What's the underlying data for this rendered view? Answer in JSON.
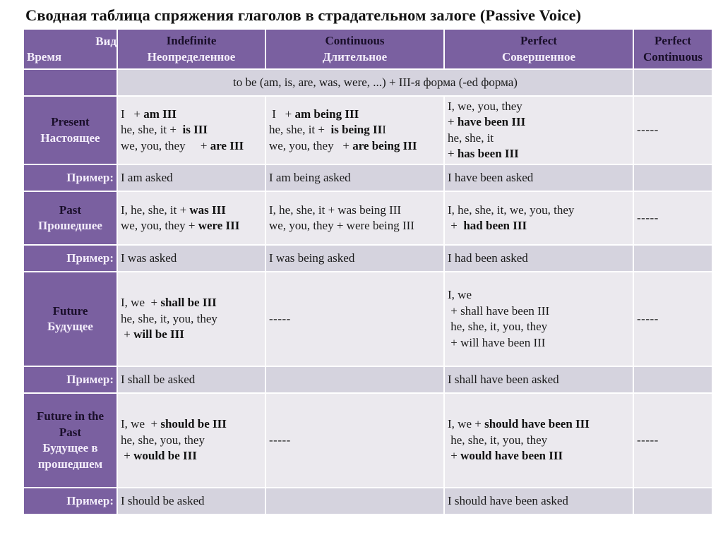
{
  "title": "Сводная таблица спряжения глаголов в страдательном залоге (Passive Voice)",
  "header": {
    "corner_top": "Вид",
    "corner_bottom": "Время",
    "columns": [
      {
        "en": "Indefinite",
        "ru": "Неопределенное"
      },
      {
        "en": "Continuous",
        "ru": "Длительное"
      },
      {
        "en": "Perfect",
        "ru": "Совершенное"
      },
      {
        "en": "Perfect",
        "ru": "Continuous"
      }
    ]
  },
  "formula": "to be (am, is, are, was, were, ...) +  III-я форма (-ed форма)",
  "example_label": "Пример:",
  "dash": "-----",
  "rows": {
    "present": {
      "en": "Present",
      "ru": "Настоящее",
      "indefinite": [
        {
          "pre": "I   + ",
          "bold": "am III",
          "post": ""
        },
        {
          "pre": "he, she, it +  ",
          "bold": "is III",
          "post": ""
        },
        {
          "pre": "we, you, they     + ",
          "bold": "are III",
          "post": ""
        }
      ],
      "continuous": [
        {
          "pre": " I   + ",
          "bold": "am being III",
          "post": ""
        },
        {
          "pre": "he, she, it +  ",
          "bold": "is being II",
          "post": "I"
        },
        {
          "pre": "we, you, they   + ",
          "bold": "are being III",
          "post": ""
        }
      ],
      "perfect": [
        {
          "pre": "I, we, you, they",
          "bold": "",
          "post": ""
        },
        {
          "pre": "+ ",
          "bold": "have been III",
          "post": ""
        },
        {
          "pre": "he, she, it",
          "bold": "",
          "post": ""
        },
        {
          "pre": "+ ",
          "bold": "has been III",
          "post": ""
        }
      ],
      "perfect_continuous": "-----",
      "examples": [
        "I am asked",
        "I am being asked",
        "I have been asked",
        ""
      ]
    },
    "past": {
      "en": "Past",
      "ru": "Прошедшее",
      "indefinite": [
        {
          "pre": "I, he, she, it + ",
          "bold": "was III",
          "post": ""
        },
        {
          "pre": "we, you, they + ",
          "bold": "were III",
          "post": ""
        }
      ],
      "continuous": [
        {
          "pre": "I, he, she, it + was being III",
          "bold": "",
          "post": ""
        },
        {
          "pre": "we, you, they + were being III",
          "bold": "",
          "post": ""
        }
      ],
      "perfect": [
        {
          "pre": "I, he, she, it, we, you, they",
          "bold": "",
          "post": ""
        },
        {
          "pre": " +  ",
          "bold": "had been III",
          "post": ""
        }
      ],
      "perfect_continuous": "-----",
      "examples": [
        "I was asked",
        "I was being asked",
        "I had been asked",
        ""
      ]
    },
    "future": {
      "en": "Future",
      "ru": "Будущее",
      "indefinite": [
        {
          "pre": "I, we  + ",
          "bold": "shall be III",
          "post": ""
        },
        {
          "pre": "he, she, it, you, they",
          "bold": "",
          "post": ""
        },
        {
          "pre": " + ",
          "bold": "will be III",
          "post": ""
        }
      ],
      "continuous": "-----",
      "perfect": [
        {
          "pre": "I, we",
          "bold": "",
          "post": ""
        },
        {
          "pre": " + shall have been III",
          "bold": "",
          "post": ""
        },
        {
          "pre": " he, she, it, you, they",
          "bold": "",
          "post": ""
        },
        {
          "pre": " + will have been III",
          "bold": "",
          "post": ""
        }
      ],
      "perfect_continuous": "-----",
      "examples": [
        "I shall be asked",
        "",
        "I shall have been asked",
        ""
      ]
    },
    "future_in_past": {
      "en": "Future in the Past",
      "ru": "Будущее в прошедшем",
      "indefinite": [
        {
          "pre": "I, we  + ",
          "bold": "should be III",
          "post": ""
        },
        {
          "pre": "he, she, you, they",
          "bold": "",
          "post": ""
        },
        {
          "pre": " + ",
          "bold": "would be III",
          "post": ""
        }
      ],
      "continuous": "-----",
      "perfect": [
        {
          "pre": "I, we + ",
          "bold": "should have been III",
          "post": ""
        },
        {
          "pre": " he, she, it, you, they",
          "bold": "",
          "post": ""
        },
        {
          "pre": " + ",
          "bold": "would have been III",
          "post": ""
        }
      ],
      "perfect_continuous": "-----",
      "examples": [
        "I should be asked",
        "",
        "I should have been asked",
        ""
      ]
    }
  },
  "colors": {
    "header_purple": "#7a60a0",
    "light_cell": "#ebe9ee",
    "example_cell": "#d5d3de",
    "header_text_dark": "#1a0f2a",
    "header_text_light": "#f4eefb"
  }
}
